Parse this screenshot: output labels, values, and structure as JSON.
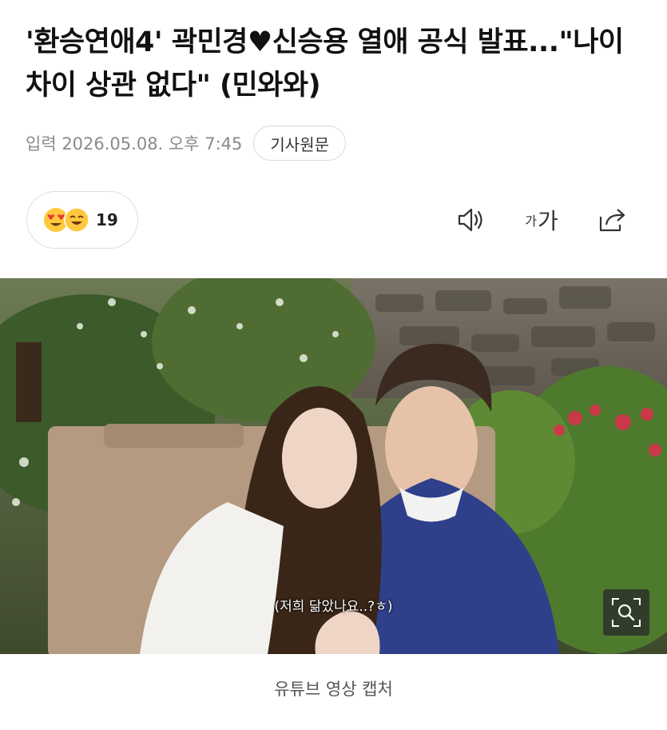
{
  "article": {
    "headline": "'환승연애4' 곽민경♥신승용 열애 공식 발표...\"나이 차이 상관 없다\" (민와와)",
    "date": "입력 2026.05.08. 오후 7:45",
    "source_button": "기사원문"
  },
  "reactions": {
    "count": "19",
    "emojis": [
      "heart-eyes-emoji",
      "laughing-emoji"
    ]
  },
  "toolbar": {
    "icons": [
      "speaker-icon",
      "font-size-icon",
      "share-icon"
    ],
    "font_size_label_small": "가",
    "font_size_label_large": "가"
  },
  "photo": {
    "subtitle": "(저희 닮았나요..?ㅎ)",
    "caption": "유튜브 영상 캡처",
    "zoom_icon": "zoom-icon"
  },
  "colors": {
    "headline": "#111111",
    "meta": "#8a8a8a",
    "border": "#dedede",
    "emoji_yellow": "#ffc83d",
    "emoji_heart": "#e53935"
  }
}
